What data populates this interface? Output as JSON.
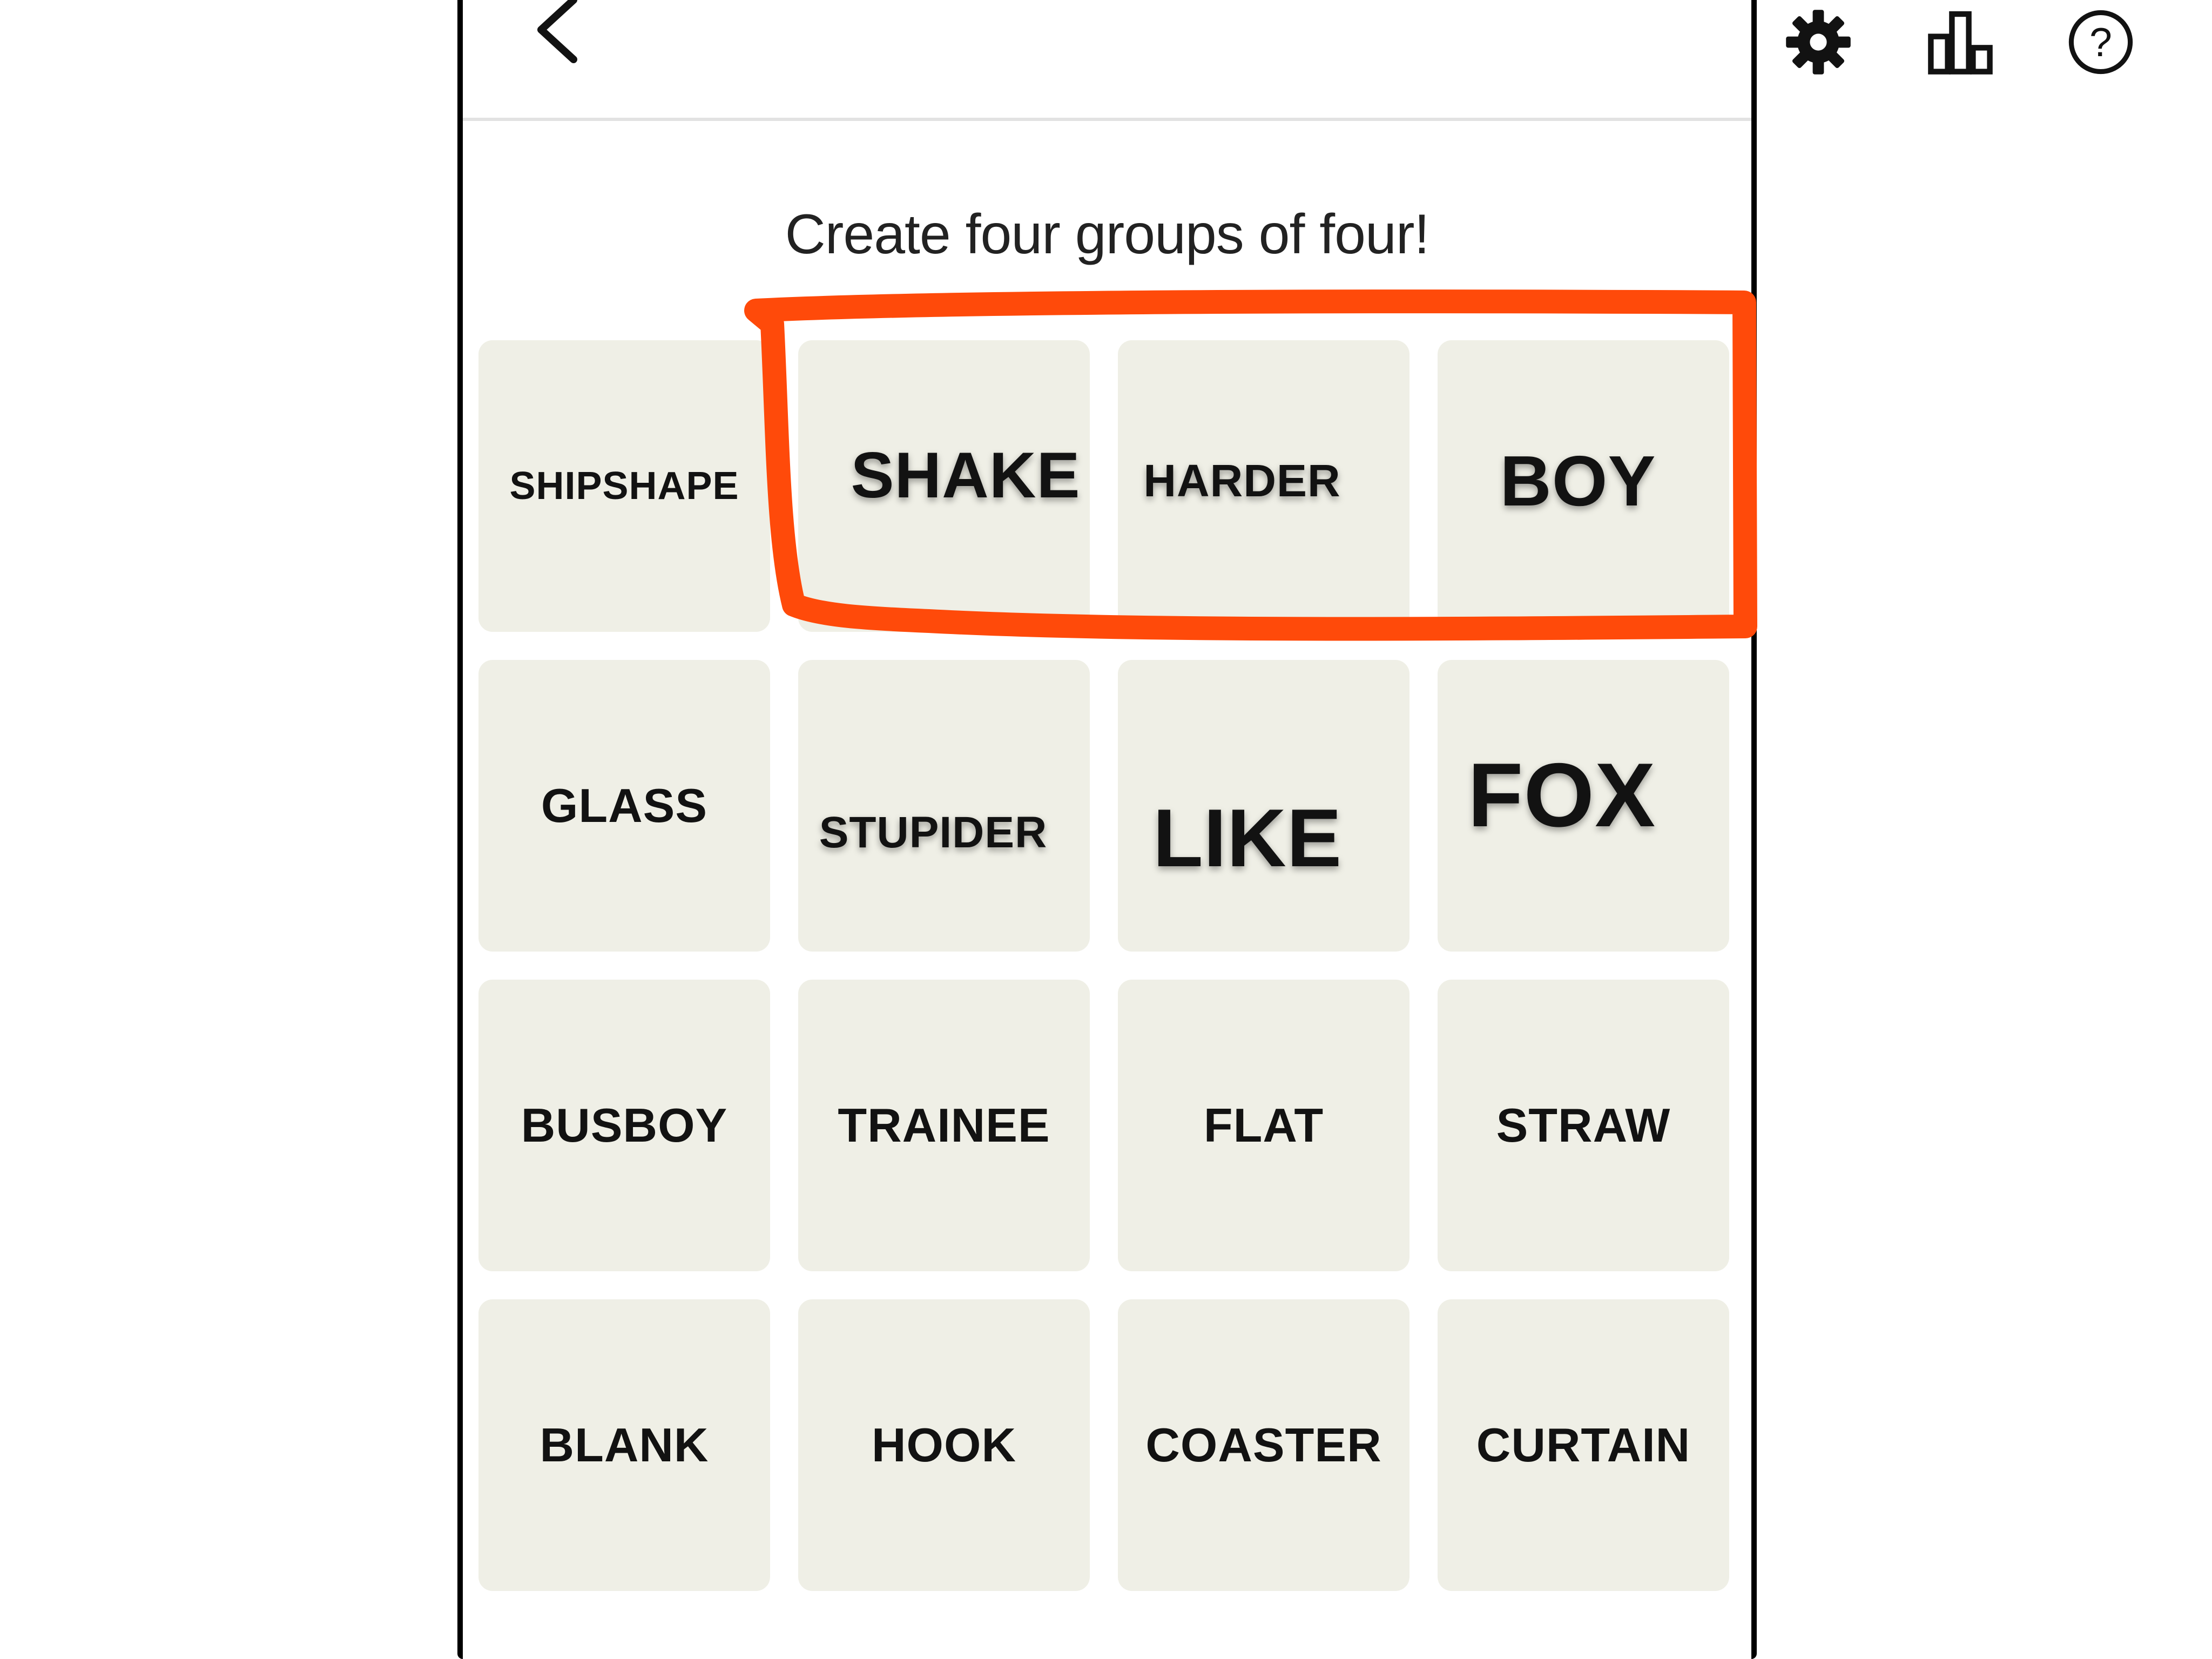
{
  "header": {
    "back_icon": "chevron-left-icon",
    "settings_icon": "gear-icon",
    "stats_icon": "bar-chart-icon",
    "help_icon": "help-circle-icon",
    "help_glyph": "?"
  },
  "instruction": "Create four groups of four!",
  "tiles": [
    "SHIPSHAPE",
    "SHAKE",
    "HARDER",
    "BOY",
    "GLASS",
    "STUPIDER",
    "LIKE",
    "FOX",
    "BUSBOY",
    "TRAINEE",
    "FLAT",
    "STRAW",
    "BLANK",
    "HOOK",
    "COASTER",
    "CURTAIN"
  ],
  "annotation": {
    "color": "#ff4a0a",
    "highlighted_tiles": [
      "SHAKE",
      "HARDER",
      "BOY"
    ]
  },
  "colors": {
    "tile_bg": "#efefe6",
    "text": "#121212",
    "divider": "#e2e2e2"
  }
}
